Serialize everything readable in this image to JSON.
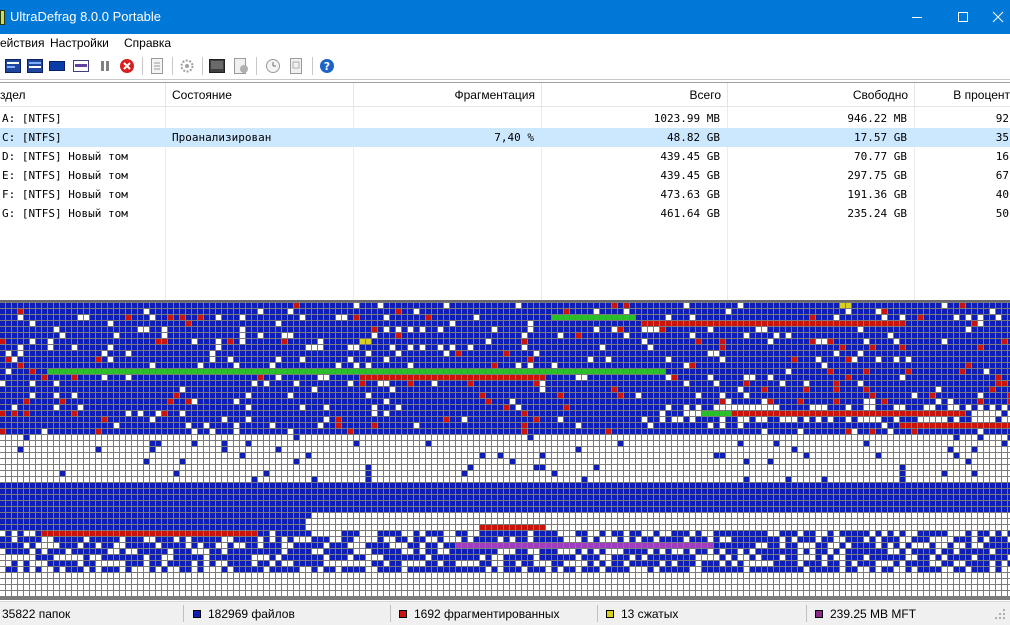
{
  "window": {
    "title": "UltraDefrag 8.0.0 Portable"
  },
  "menu": {
    "items": [
      "ействия",
      "Настройки",
      "Справка"
    ]
  },
  "toolbar": {
    "buttons": [
      "analyze-icon",
      "defragment-icon",
      "quick-optimize-icon",
      "full-optimize-icon",
      "pause-icon",
      "stop-icon",
      "report-icon",
      "settings-icon",
      "boot-time-icon",
      "boot-script-icon",
      "schedule-icon",
      "log-icon",
      "help-icon"
    ]
  },
  "drives": {
    "columns": [
      "здел",
      "Состояние",
      "Фрагментация",
      "Всего",
      "Свободно",
      "В процент"
    ],
    "rows": [
      {
        "volume": "A: [NTFS]",
        "status": "",
        "fragmentation": "",
        "total": "1023.99 MB",
        "free": "946.22 MB",
        "percent": "92"
      },
      {
        "volume": "C: [NTFS]",
        "status": "Проанализирован",
        "fragmentation": "7,40 %",
        "total": "48.82 GB",
        "free": "17.57 GB",
        "percent": "35"
      },
      {
        "volume": "D: [NTFS]  Новый том",
        "status": "",
        "fragmentation": "",
        "total": "439.45 GB",
        "free": "70.77 GB",
        "percent": "16"
      },
      {
        "volume": "E: [NTFS]  Новый том",
        "status": "",
        "fragmentation": "",
        "total": "439.45 GB",
        "free": "297.75 GB",
        "percent": "67"
      },
      {
        "volume": "F: [NTFS]  Новый том",
        "status": "",
        "fragmentation": "",
        "total": "473.63 GB",
        "free": "191.36 GB",
        "percent": "40"
      },
      {
        "volume": "G: [NTFS]  Новый том",
        "status": "",
        "fragmentation": "",
        "total": "461.64 GB",
        "free": "235.24 GB",
        "percent": "50"
      }
    ],
    "selected_index": 1
  },
  "cluster_map": {
    "colors": {
      "free": "#ffffff",
      "used": "#0f1eb4",
      "fragmented": "#c8140a",
      "system": "#2cbf2c",
      "mft": "#a03cc0",
      "compressed": "#d8d020",
      "grid": "#7b7b7b"
    }
  },
  "statusbar": {
    "folders": "35822 папок",
    "files": "182969 файлов",
    "fragmented": "1692 фрагментированных",
    "compressed": "13 сжатых",
    "mft": "239.25 MB MFT",
    "colors": {
      "files": "#0f1eb4",
      "fragmented": "#c8140a",
      "compressed": "#d8d020",
      "mft": "#8a2a8a"
    }
  }
}
